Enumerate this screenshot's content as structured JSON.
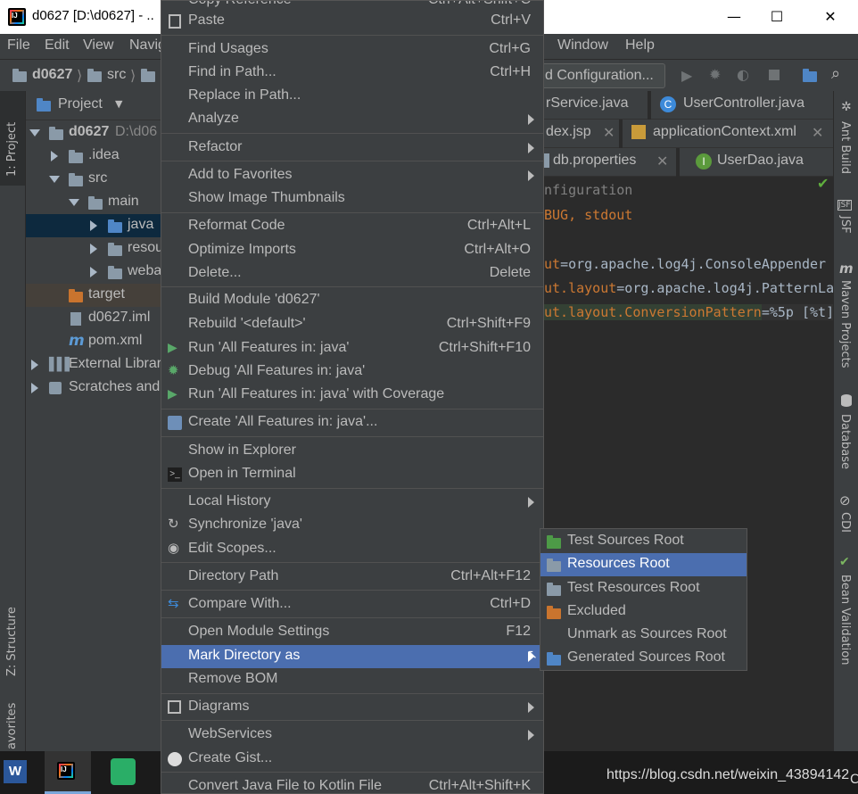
{
  "window": {
    "title": "d0627 [D:\\d0627] - ..",
    "controls": {
      "minimize": "—",
      "maximize": "☐",
      "close": "✕"
    }
  },
  "menubar": {
    "file": "File",
    "edit": "Edit",
    "view": "View",
    "navigate": "Navig",
    "window": "Window",
    "help": "Help"
  },
  "navbar": {
    "crumbs": [
      "d0627",
      "src"
    ],
    "run_config": "d Configuration..."
  },
  "left_strip": {
    "project_tab": "1: Project",
    "structure_tab": "Z: Structure",
    "favorites_tab": "avorites"
  },
  "project_panel": {
    "header": "Project",
    "tree": [
      {
        "label": "d0627",
        "extra": "D:\\d06"
      },
      {
        "label": ".idea"
      },
      {
        "label": "src"
      },
      {
        "label": "main"
      },
      {
        "label": "java"
      },
      {
        "label": "resou"
      },
      {
        "label": "weba"
      },
      {
        "label": "target"
      },
      {
        "label": "d0627.iml"
      },
      {
        "label": "pom.xml"
      },
      {
        "label": "External Librar"
      },
      {
        "label": "Scratches and"
      }
    ]
  },
  "editor": {
    "tabs_row1": [
      "rService.java",
      "UserController.java"
    ],
    "tabs_row2": [
      "dex.jsp",
      "applicationContext.xml"
    ],
    "tabs_row3": [
      "db.properties",
      "UserDao.java"
    ],
    "lines": [
      {
        "a": "nfiguration",
        "b": ""
      },
      {
        "a": "BUG, stdout",
        "b": ""
      },
      {
        "a": "",
        "b": ""
      },
      {
        "a": "ut",
        "b": "=org.apache.log4j.ConsoleAppender"
      },
      {
        "a": "ut.layout",
        "b": "=org.apache.log4j.PatternLa"
      },
      {
        "a": "ut.layout.ConversionPattern",
        "b": "=%5p [%t]"
      }
    ]
  },
  "right_strip": {
    "ant": "Ant Build",
    "jsf": "JSF",
    "maven": "Maven Projects",
    "database": "Database",
    "cdi": "CDI",
    "bean": "Bean Validation"
  },
  "context_menu": {
    "items": [
      {
        "label": "Copy Reference",
        "shortcut": "Ctrl+Alt+Shift+C"
      },
      {
        "label": "Paste",
        "shortcut": "Ctrl+V"
      },
      {
        "label": "Find Usages",
        "shortcut": "Ctrl+G"
      },
      {
        "label": "Find in Path...",
        "shortcut": "Ctrl+H"
      },
      {
        "label": "Replace in Path...",
        "shortcut": ""
      },
      {
        "label": "Analyze",
        "shortcut": ""
      },
      {
        "label": "Refactor",
        "shortcut": ""
      },
      {
        "label": "Add to Favorites",
        "shortcut": ""
      },
      {
        "label": "Show Image Thumbnails",
        "shortcut": ""
      },
      {
        "label": "Reformat Code",
        "shortcut": "Ctrl+Alt+L"
      },
      {
        "label": "Optimize Imports",
        "shortcut": "Ctrl+Alt+O"
      },
      {
        "label": "Delete...",
        "shortcut": "Delete"
      },
      {
        "label": "Build Module 'd0627'",
        "shortcut": ""
      },
      {
        "label": "Rebuild '<default>'",
        "shortcut": "Ctrl+Shift+F9"
      },
      {
        "label": "Run 'All Features in: java'",
        "shortcut": "Ctrl+Shift+F10"
      },
      {
        "label": "Debug 'All Features in: java'",
        "shortcut": ""
      },
      {
        "label": "Run 'All Features in: java' with Coverage",
        "shortcut": ""
      },
      {
        "label": "Create 'All Features in: java'...",
        "shortcut": ""
      },
      {
        "label": "Show in Explorer",
        "shortcut": ""
      },
      {
        "label": "Open in Terminal",
        "shortcut": ""
      },
      {
        "label": "Local History",
        "shortcut": ""
      },
      {
        "label": "Synchronize 'java'",
        "shortcut": ""
      },
      {
        "label": "Edit Scopes...",
        "shortcut": ""
      },
      {
        "label": "Directory Path",
        "shortcut": "Ctrl+Alt+F12"
      },
      {
        "label": "Compare With...",
        "shortcut": "Ctrl+D"
      },
      {
        "label": "Open Module Settings",
        "shortcut": "F12"
      },
      {
        "label": "Mark Directory as",
        "shortcut": ""
      },
      {
        "label": "Remove BOM",
        "shortcut": ""
      },
      {
        "label": "Diagrams",
        "shortcut": ""
      },
      {
        "label": "WebServices",
        "shortcut": ""
      },
      {
        "label": "Create Gist...",
        "shortcut": ""
      },
      {
        "label": "Convert Java File to Kotlin File",
        "shortcut": "Ctrl+Alt+Shift+K"
      }
    ]
  },
  "submenu": {
    "items": [
      "Test Sources Root",
      "Resources Root",
      "Test Resources Root",
      "Excluded",
      "Unmark as Sources Root",
      "Generated Sources Root"
    ]
  },
  "taskbar": {
    "watermark": "https://blog.csdn.net/weixin_43894142",
    "trailing": "C"
  },
  "colors": {
    "selection": "#4b6eaf",
    "panel": "#3c3f41",
    "editor_bg": "#2b2b2b",
    "keyword_orange": "#cc7832",
    "string_green": "#6a8759"
  }
}
